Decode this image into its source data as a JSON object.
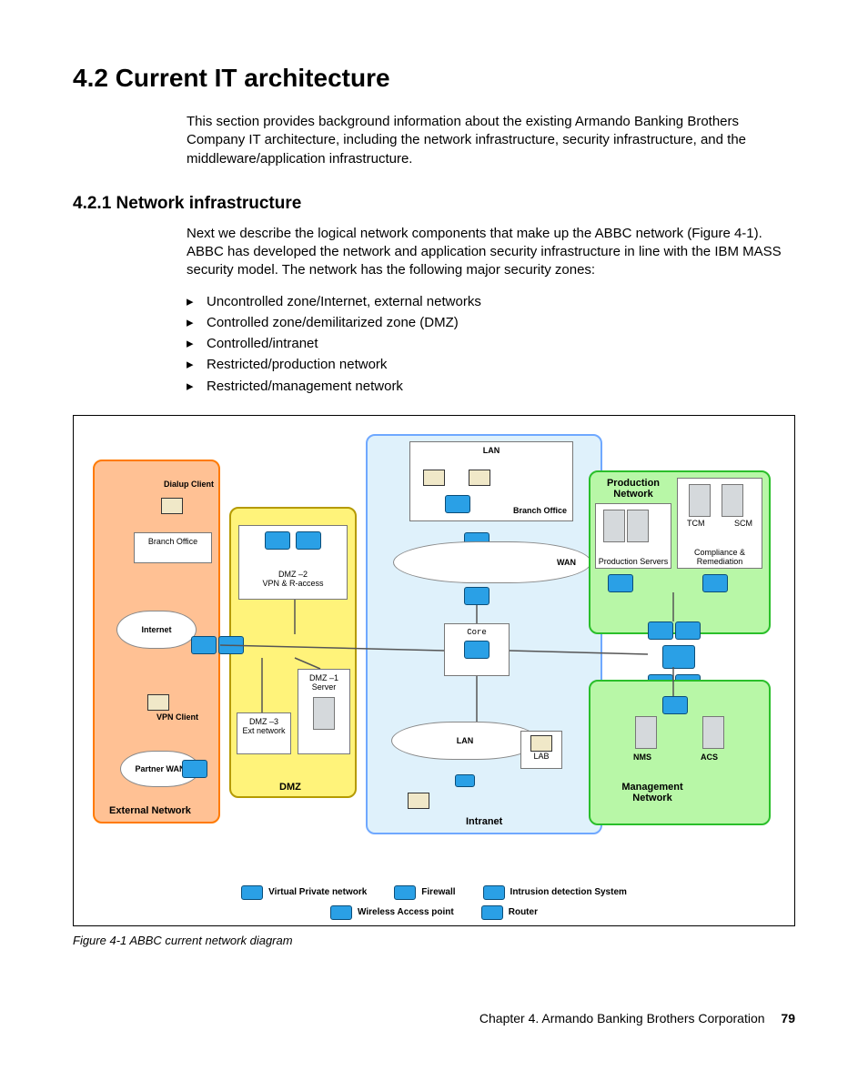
{
  "heading": "4.2  Current IT architecture",
  "intro": "This section provides background information about the existing Armando Banking Brothers Company IT architecture, including the network infrastructure, security infrastructure, and the middleware/application infrastructure.",
  "subheading": "4.2.1  Network infrastructure",
  "subpara": "Next we describe the logical network components that make up the ABBC network (Figure 4-1). ABBC has developed the network and application security infrastructure in line with the IBM MASS security model. The network has the following major security zones:",
  "zones": [
    "Uncontrolled zone/Internet, external networks",
    "Controlled zone/demilitarized zone (DMZ)",
    "Controlled/intranet",
    "Restricted/production network",
    "Restricted/management network"
  ],
  "diagram": {
    "externalNetwork": "External Network",
    "dmz": "DMZ",
    "intranet": "Intranet",
    "productionNetwork": "Production Network",
    "managementNetwork": "Management Network",
    "dialupClient": "Dialup Client",
    "branchOffice": "Branch Office",
    "internet": "Internet",
    "vpnClient": "VPN Client",
    "partnerWan": "Partner WAN",
    "dmz2": "DMZ –2",
    "dmz2b": "VPN & R-access",
    "dmz1": "DMZ –1",
    "dmz1b": "Server",
    "dmz3": "DMZ –3",
    "dmz3b": "Ext network",
    "lan": "LAN",
    "wan": "WAN",
    "core": "Core",
    "lab": "LAB",
    "productionServers": "Production Servers",
    "compliance": "Compliance & Remediation",
    "tcm": "TCM",
    "scm": "SCM",
    "nms": "NMS",
    "acs": "ACS"
  },
  "legend": {
    "vpn": "Virtual Private network",
    "wap": "Wireless Access point",
    "firewall": "Firewall",
    "router": "Router",
    "ids": "Intrusion detection System"
  },
  "caption": "Figure 4-1   ABBC current network diagram",
  "footer": {
    "chapter": "Chapter 4. Armando Banking Brothers Corporation",
    "page": "79"
  }
}
